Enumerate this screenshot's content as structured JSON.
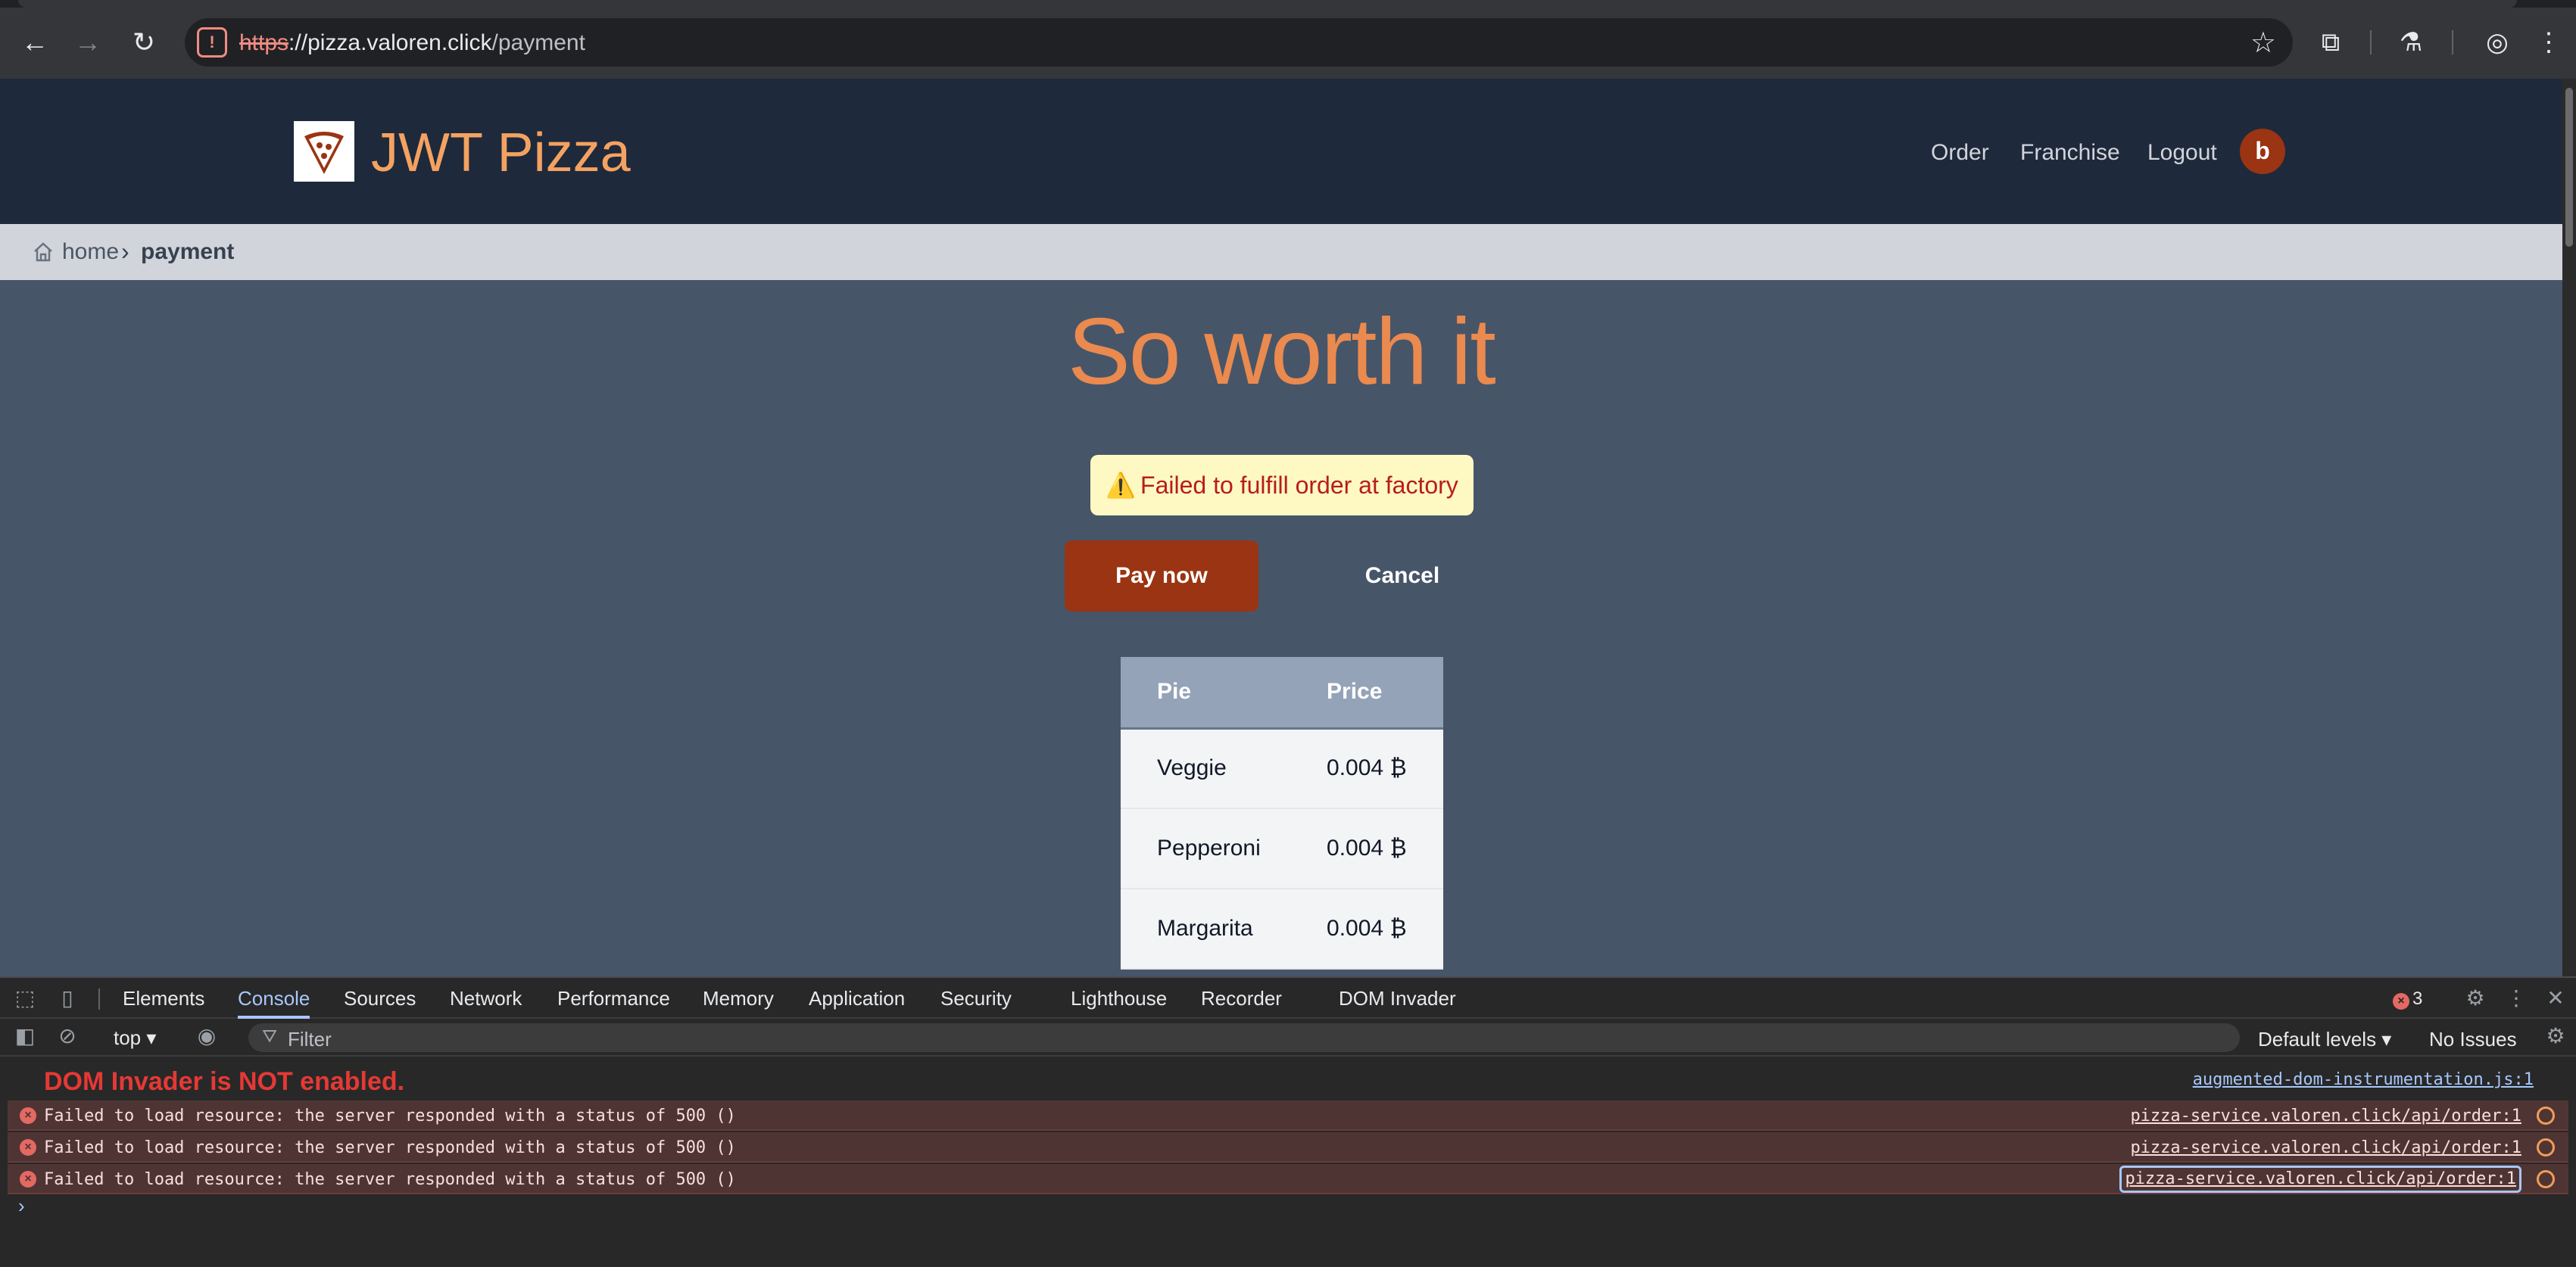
{
  "browser": {
    "url_scheme": "https",
    "url_host": "pizza.valoren.click",
    "url_path": "/payment",
    "back_icon": "←",
    "forward_icon": "→",
    "reload_icon": "↻",
    "star_icon": "☆",
    "extensions_icon": "⧉",
    "labs_icon": "⚗",
    "profile_icon": "◎",
    "menu_icon": "⋮"
  },
  "site": {
    "brand": "JWT Pizza",
    "nav": [
      "Order",
      "Franchise",
      "Logout"
    ],
    "avatar_letter": "b",
    "colors": {
      "header": "#1e293b",
      "accent": "#9a3412",
      "brand": "#f4a261"
    }
  },
  "breadcrumb": {
    "home": "home",
    "separator": "›",
    "current": "payment"
  },
  "main": {
    "headline": "So worth it",
    "alert_icon": "⚠️",
    "alert_text": "Failed to fulfill order at factory",
    "pay_button": "Pay now",
    "cancel_button": "Cancel"
  },
  "order_table": {
    "headers": [
      "Pie",
      "Price"
    ],
    "rows": [
      {
        "pie": "Veggie",
        "price": "0.004 ₿"
      },
      {
        "pie": "Pepperoni",
        "price": "0.004 ₿"
      },
      {
        "pie": "Margarita",
        "price": "0.004 ₿"
      }
    ]
  },
  "devtools": {
    "tabs": [
      "Elements",
      "Console",
      "Sources",
      "Network",
      "Performance",
      "Memory",
      "Application",
      "Security",
      "Lighthouse",
      "Recorder",
      "DOM Invader"
    ],
    "active_tab": "Console",
    "error_count": "3",
    "context": "top ▾",
    "filter_placeholder": "Filter",
    "levels": "Default levels ▾",
    "issues": "No Issues",
    "dom_invader_warning": "DOM Invader is NOT enabled.",
    "dom_invader_source": "augmented-dom-instrumentation.js:1",
    "errors": [
      {
        "message": "Failed to load resource: the server responded with a status of 500 ()",
        "source": "pizza-service.valoren.click/api/order:1"
      },
      {
        "message": "Failed to load resource: the server responded with a status of 500 ()",
        "source": "pizza-service.valoren.click/api/order:1"
      },
      {
        "message": "Failed to load resource: the server responded with a status of 500 ()",
        "source": "pizza-service.valoren.click/api/order:1"
      }
    ],
    "prompt": "›"
  }
}
